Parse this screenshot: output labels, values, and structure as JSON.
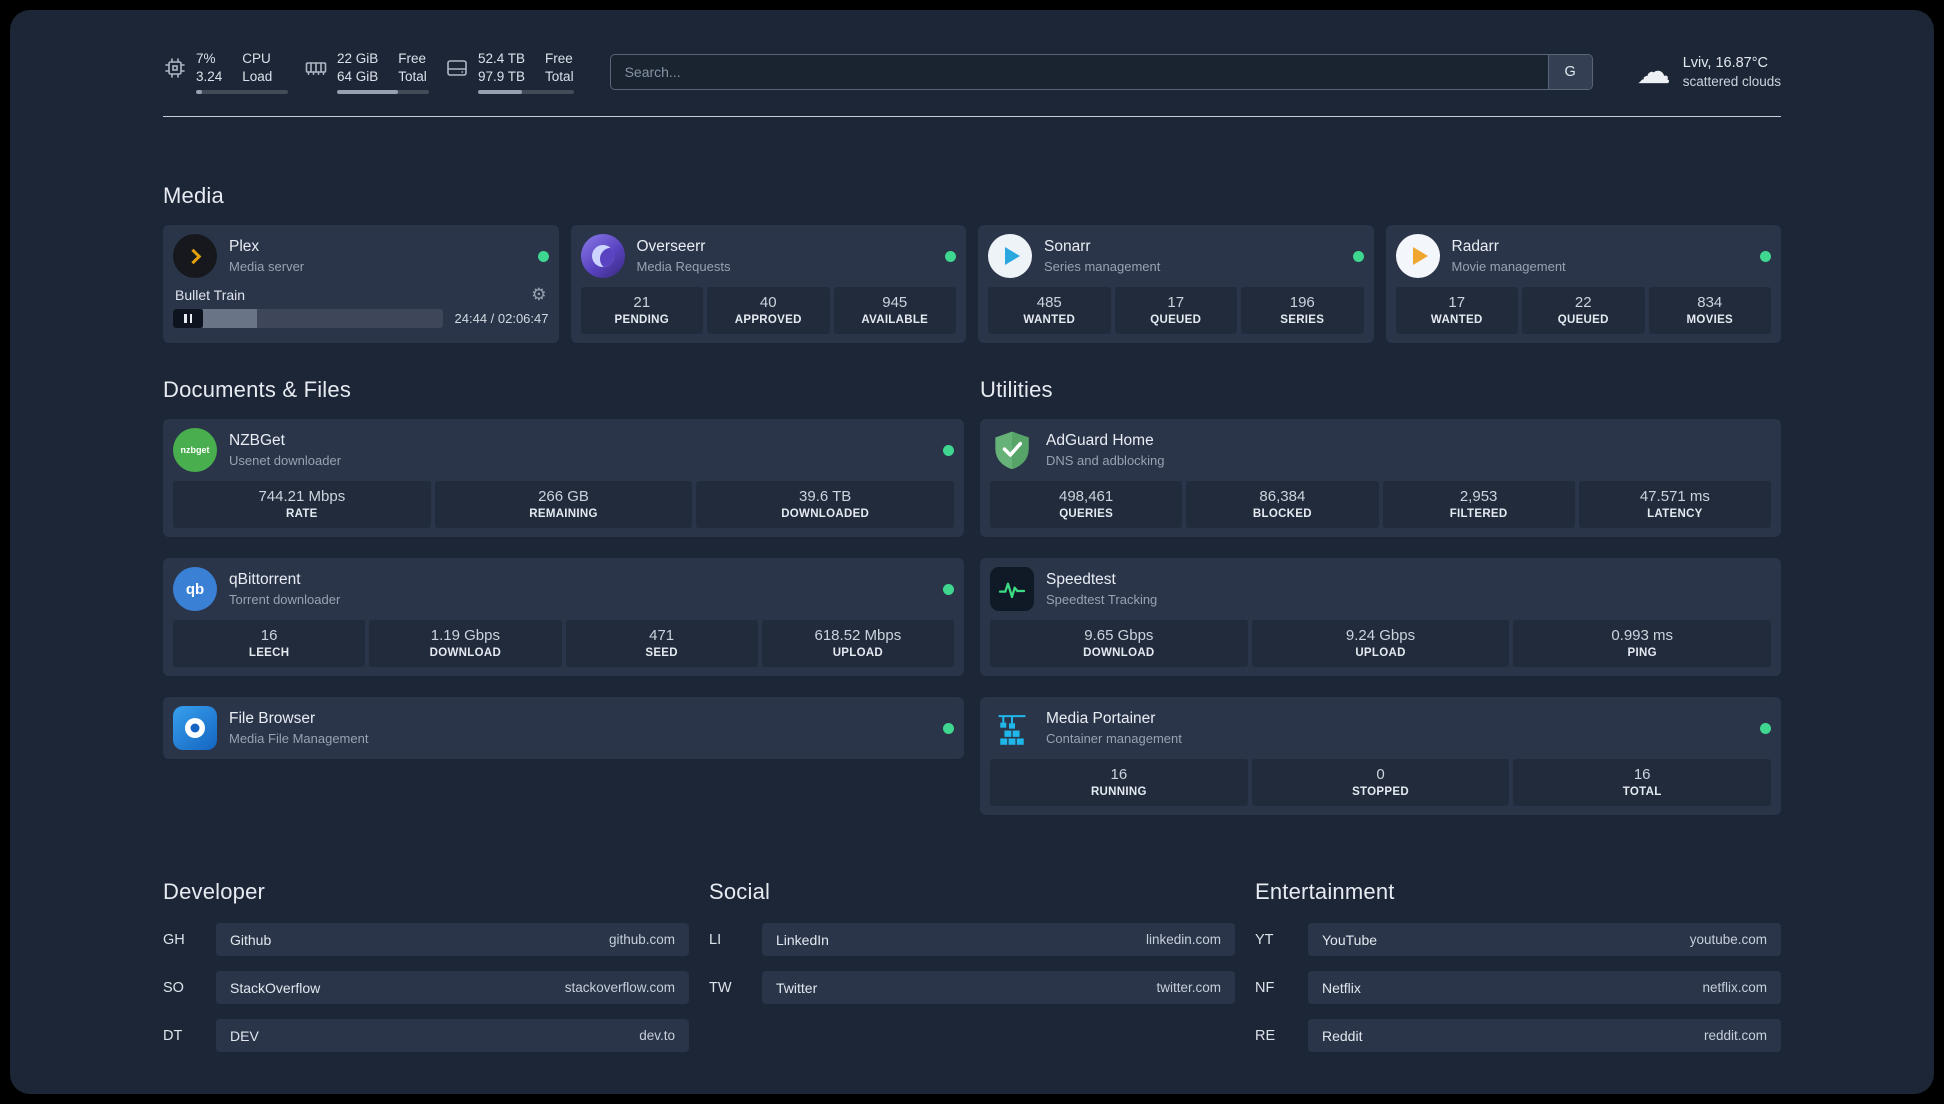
{
  "topbar": {
    "resources": [
      {
        "name": "cpu",
        "top_value": "7%",
        "bottom_value": "3.24",
        "top_label": "CPU",
        "bottom_label": "Load",
        "percent": 7
      },
      {
        "name": "memory",
        "top_value": "22 GiB",
        "bottom_value": "64 GiB",
        "top_label": "Free",
        "bottom_label": "Total",
        "percent": 66
      },
      {
        "name": "disk",
        "top_value": "52.4 TB",
        "bottom_value": "97.9 TB",
        "top_label": "Free",
        "bottom_label": "Total",
        "percent": 46
      }
    ],
    "search": {
      "placeholder": "Search...",
      "provider": "G"
    },
    "weather": {
      "location": "Lviv, 16.87°C",
      "condition": "scattered clouds"
    }
  },
  "sections": {
    "media": {
      "title": "Media",
      "plex": {
        "name": "Plex",
        "desc": "Media server",
        "icon": "plex-icon",
        "online": true,
        "player": {
          "title": "Bullet Train",
          "time": "24:44 / 02:06:47",
          "progress": 20
        }
      },
      "overseerr": {
        "name": "Overseerr",
        "desc": "Media Requests",
        "icon": "overseerr-icon",
        "online": true,
        "stats": [
          {
            "value": "21",
            "label": "PENDING"
          },
          {
            "value": "40",
            "label": "APPROVED"
          },
          {
            "value": "945",
            "label": "AVAILABLE"
          }
        ]
      },
      "sonarr": {
        "name": "Sonarr",
        "desc": "Series management",
        "icon": "sonarr-icon",
        "online": true,
        "stats": [
          {
            "value": "485",
            "label": "WANTED"
          },
          {
            "value": "17",
            "label": "QUEUED"
          },
          {
            "value": "196",
            "label": "SERIES"
          }
        ]
      },
      "radarr": {
        "name": "Radarr",
        "desc": "Movie management",
        "icon": "radarr-icon",
        "online": true,
        "stats": [
          {
            "value": "17",
            "label": "WANTED"
          },
          {
            "value": "22",
            "label": "QUEUED"
          },
          {
            "value": "834",
            "label": "MOVIES"
          }
        ]
      }
    },
    "documents": {
      "title": "Documents & Files",
      "nzbget": {
        "name": "NZBGet",
        "desc": "Usenet downloader",
        "icon": "nzbget-icon",
        "icon_text": "nzbget",
        "online": true,
        "stats": [
          {
            "value": "744.21 Mbps",
            "label": "RATE"
          },
          {
            "value": "266 GB",
            "label": "REMAINING"
          },
          {
            "value": "39.6 TB",
            "label": "DOWNLOADED"
          }
        ]
      },
      "qbittorrent": {
        "name": "qBittorrent",
        "desc": "Torrent downloader",
        "icon": "qbittorrent-icon",
        "icon_text": "qb",
        "online": true,
        "stats": [
          {
            "value": "16",
            "label": "LEECH"
          },
          {
            "value": "1.19 Gbps",
            "label": "DOWNLOAD"
          },
          {
            "value": "471",
            "label": "SEED"
          },
          {
            "value": "618.52 Mbps",
            "label": "UPLOAD"
          }
        ]
      },
      "filebrowser": {
        "name": "File Browser",
        "desc": "Media File Management",
        "icon": "filebrowser-icon",
        "online": true
      }
    },
    "utilities": {
      "title": "Utilities",
      "adguard": {
        "name": "AdGuard Home",
        "desc": "DNS and adblocking",
        "icon": "adguard-icon",
        "online": false,
        "stats": [
          {
            "value": "498,461",
            "label": "QUERIES"
          },
          {
            "value": "86,384",
            "label": "BLOCKED"
          },
          {
            "value": "2,953",
            "label": "FILTERED"
          },
          {
            "value": "47.571 ms",
            "label": "LATENCY"
          }
        ]
      },
      "speedtest": {
        "name": "Speedtest",
        "desc": "Speedtest Tracking",
        "icon": "speedtest-icon",
        "online": false,
        "stats": [
          {
            "value": "9.65 Gbps",
            "label": "DOWNLOAD"
          },
          {
            "value": "9.24 Gbps",
            "label": "UPLOAD"
          },
          {
            "value": "0.993 ms",
            "label": "PING"
          }
        ]
      },
      "portainer": {
        "name": "Media Portainer",
        "desc": "Container management",
        "icon": "portainer-icon",
        "online": true,
        "stats": [
          {
            "value": "16",
            "label": "RUNNING"
          },
          {
            "value": "0",
            "label": "STOPPED"
          },
          {
            "value": "16",
            "label": "TOTAL"
          }
        ]
      }
    },
    "bookmarks": [
      {
        "title": "Developer",
        "items": [
          {
            "abbr": "GH",
            "name": "Github",
            "url": "github.com"
          },
          {
            "abbr": "SO",
            "name": "StackOverflow",
            "url": "stackoverflow.com"
          },
          {
            "abbr": "DT",
            "name": "DEV",
            "url": "dev.to"
          }
        ]
      },
      {
        "title": "Social",
        "items": [
          {
            "abbr": "LI",
            "name": "LinkedIn",
            "url": "linkedin.com"
          },
          {
            "abbr": "TW",
            "name": "Twitter",
            "url": "twitter.com"
          }
        ]
      },
      {
        "title": "Entertainment",
        "items": [
          {
            "abbr": "YT",
            "name": "YouTube",
            "url": "youtube.com"
          },
          {
            "abbr": "NF",
            "name": "Netflix",
            "url": "netflix.com"
          },
          {
            "abbr": "RE",
            "name": "Reddit",
            "url": "reddit.com"
          }
        ]
      }
    ]
  },
  "colors": {
    "background": "#1d2637",
    "card": "#2a3549",
    "stat_block": "#212b3c",
    "online_dot": "#3fd68f"
  }
}
